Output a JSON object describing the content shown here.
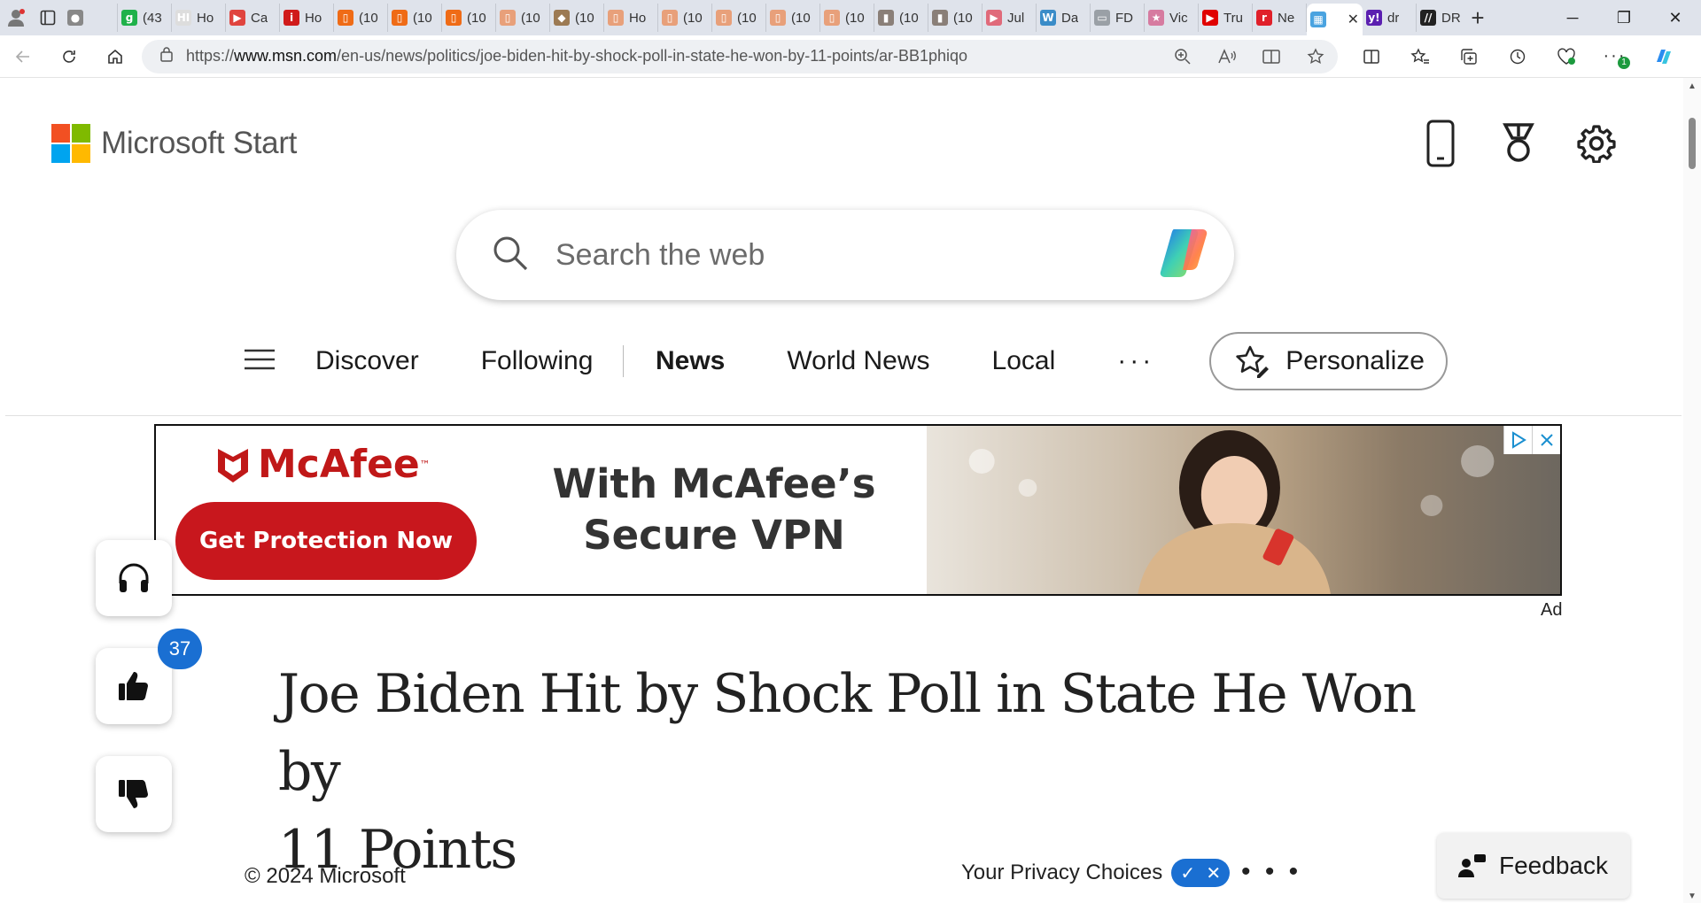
{
  "browser": {
    "tabs": [
      {
        "title": "",
        "fav_color": "#888888",
        "fav_char": "●"
      },
      {
        "title": "(43",
        "fav_color": "#1fb14a",
        "fav_char": "g"
      },
      {
        "title": "Ho",
        "fav_color": "#dddddd",
        "fav_char": "HI"
      },
      {
        "title": "Ca",
        "fav_color": "#e0443e",
        "fav_char": "▶"
      },
      {
        "title": "Ho",
        "fav_color": "#d01a1a",
        "fav_char": "i"
      },
      {
        "title": "(10",
        "fav_color": "#ef6b16",
        "fav_char": "▯"
      },
      {
        "title": "(10",
        "fav_color": "#ef6b16",
        "fav_char": "▯"
      },
      {
        "title": "(10",
        "fav_color": "#ef6b16",
        "fav_char": "▯"
      },
      {
        "title": "(10",
        "fav_color": "#e8a07a",
        "fav_char": "▯"
      },
      {
        "title": "(10",
        "fav_color": "#9c7a53",
        "fav_char": "◆"
      },
      {
        "title": "Ho",
        "fav_color": "#e8a07a",
        "fav_char": "▯"
      },
      {
        "title": "(10",
        "fav_color": "#e8a07a",
        "fav_char": "▯"
      },
      {
        "title": "(10",
        "fav_color": "#e8a07a",
        "fav_char": "▯"
      },
      {
        "title": "(10",
        "fav_color": "#e8a07a",
        "fav_char": "▯"
      },
      {
        "title": "(10",
        "fav_color": "#e8a07a",
        "fav_char": "▯"
      },
      {
        "title": "(10",
        "fav_color": "#8a7f78",
        "fav_char": "▮"
      },
      {
        "title": "(10",
        "fav_color": "#8a7f78",
        "fav_char": "▮"
      },
      {
        "title": "Jul",
        "fav_color": "#e06a7a",
        "fav_char": "▶"
      },
      {
        "title": "Da",
        "fav_color": "#3a8cc8",
        "fav_char": "W"
      },
      {
        "title": "FD",
        "fav_color": "#9aa0a6",
        "fav_char": "▭"
      },
      {
        "title": "Vic",
        "fav_color": "#d67ba0",
        "fav_char": "★"
      },
      {
        "title": "Tru",
        "fav_color": "#e00000",
        "fav_char": "▶"
      },
      {
        "title": "Ne",
        "fav_color": "#e0202a",
        "fav_char": "r"
      },
      {
        "title": "",
        "fav_color": "#4aa3e0",
        "fav_char": "▦",
        "active": true
      },
      {
        "title": "dr",
        "fav_color": "#5b1fb0",
        "fav_char": "y!"
      },
      {
        "title": "DR",
        "fav_color": "#222222",
        "fav_char": "//"
      }
    ],
    "new_tab_symbol": "+",
    "url_prefix": "https://",
    "url_host": "www.msn.com",
    "url_path": "/en-us/news/politics/joe-biden-hit-by-shock-poll-in-state-he-won-by-11-points/ar-BB1phiqo",
    "extension_badge": "1"
  },
  "header": {
    "brand": "Microsoft Start"
  },
  "search": {
    "placeholder": "Search the web"
  },
  "nav": {
    "items": [
      "Discover",
      "Following",
      "News",
      "World News",
      "Local"
    ],
    "more": "···",
    "personalize": "Personalize"
  },
  "ad": {
    "brand": "McAfee",
    "trademark": "™",
    "cta": "Get Protection Now",
    "headline_line1": "With McAfee’s",
    "headline_line2": "Secure VPN",
    "label": "Ad"
  },
  "article": {
    "like_count": "37",
    "headline_line1": "Joe Biden Hit by Shock Poll in State He Won by",
    "headline_line2": "11 Points"
  },
  "footer": {
    "copyright": "© 2024 Microsoft",
    "privacy": "Your Privacy Choices",
    "more": "• • •",
    "feedback": "Feedback"
  },
  "colors": {
    "accent": "#1a6fd2",
    "ad_red": "#c8171d",
    "ms_red": "#f25022",
    "ms_green": "#7fba00",
    "ms_blue": "#00a4ef",
    "ms_yellow": "#ffb900"
  }
}
